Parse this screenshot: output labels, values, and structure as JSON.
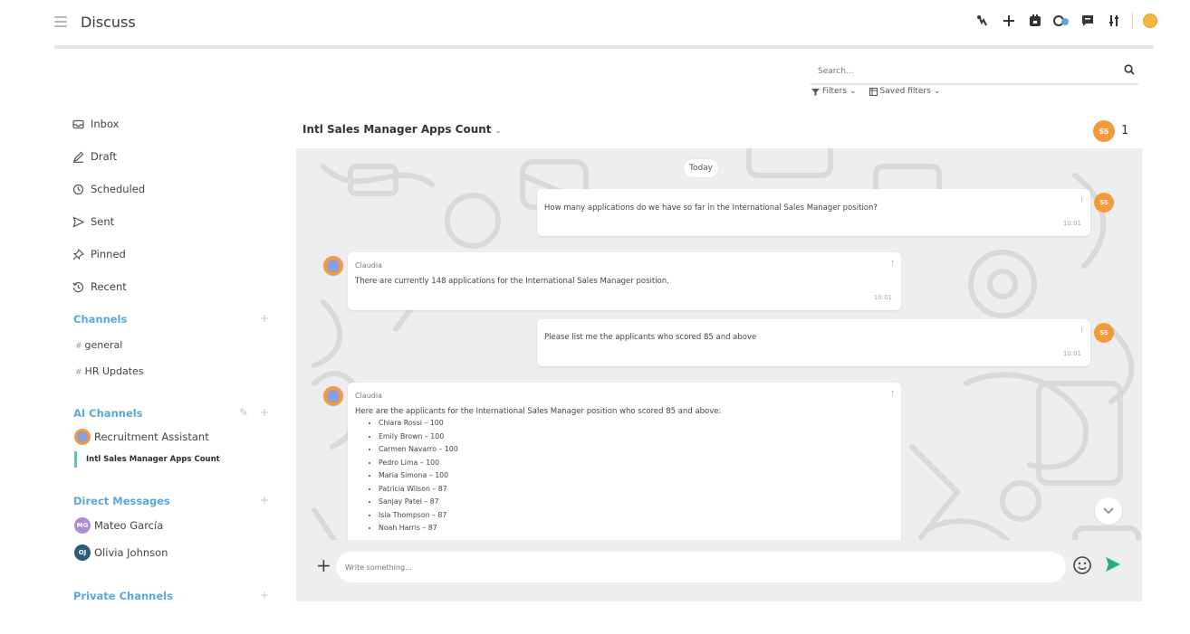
{
  "app": {
    "title": "Discuss"
  },
  "search": {
    "placeholder": "Search...",
    "filters_label": "Filters",
    "saved_filters_label": "Saved filters"
  },
  "sidebar": {
    "nav": [
      {
        "label": "Inbox",
        "icon": "inbox-icon"
      },
      {
        "label": "Draft",
        "icon": "pencil-icon"
      },
      {
        "label": "Scheduled",
        "icon": "clock-icon"
      },
      {
        "label": "Sent",
        "icon": "send-icon"
      },
      {
        "label": "Pinned",
        "icon": "pin-icon"
      },
      {
        "label": "Recent",
        "icon": "history-icon"
      }
    ],
    "channels_title": "Channels",
    "channels": [
      {
        "label": "general"
      },
      {
        "label": "HR Updates"
      }
    ],
    "ai_channels_title": "AI Channels",
    "ai_channels": [
      {
        "label": "Recruitment Assistant"
      },
      {
        "label": "Intl Sales Manager Apps Count",
        "active": true
      }
    ],
    "dm_title": "Direct Messages",
    "dms": [
      {
        "label": "Mateo García",
        "initials": "MG"
      },
      {
        "label": "Olivia Johnson",
        "initials": "OJ"
      }
    ],
    "private_title": "Private Channels"
  },
  "chat": {
    "title": "Intl Sales Manager Apps Count",
    "member_initials": "SS",
    "member_count": "1",
    "day_label": "Today",
    "composer_placeholder": "Write something...",
    "messages": [
      {
        "from": "user",
        "avatar": "SS",
        "text": "How many applications do we have so far in the International Sales Manager position?",
        "time": "10:01"
      },
      {
        "from": "bot",
        "author": "Claudia",
        "text": "There are currently 148 applications for the International Sales Manager position.",
        "time": "10:01"
      },
      {
        "from": "user",
        "avatar": "SS",
        "text": "Please list me the applicants who scored 85 and above",
        "time": "10:01"
      },
      {
        "from": "bot",
        "author": "Claudia",
        "text": "Here are the applicants for the International Sales Manager position who scored 85 and above:",
        "list": [
          "Chiara Rossi – 100",
          "Emily Brown – 100",
          "Carmen Navarro – 100",
          "Pedro Lima – 100",
          "Maria Simona – 100",
          "Patricia Wilson – 87",
          "Sanjay Patel – 87",
          "Isla Thompson – 87",
          "Noah Harris – 87"
        ]
      }
    ]
  },
  "colors": {
    "accent": "#5aa7e0",
    "avatar_orange": "#f59a3b",
    "send_green": "#21b07a",
    "active_bar": "#5ec0c8"
  }
}
